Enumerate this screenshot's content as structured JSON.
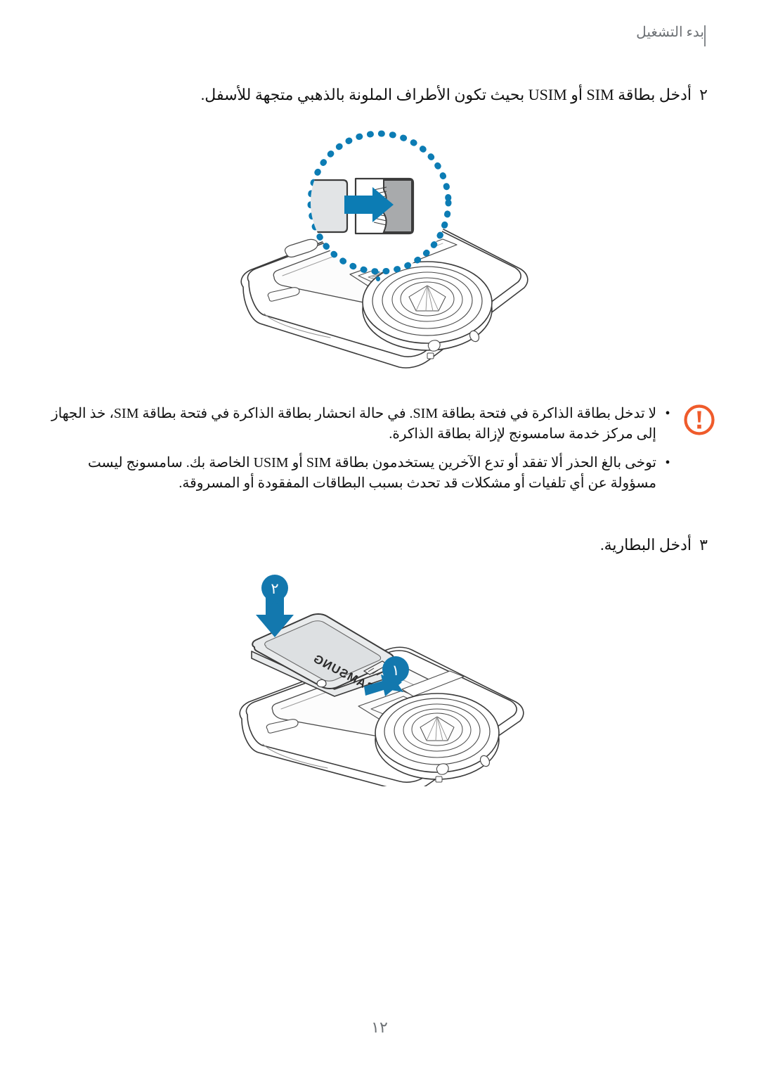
{
  "header": {
    "title": "بدء التشغيل"
  },
  "steps": [
    {
      "number": "٢",
      "text": "أدخل بطاقة SIM أو USIM بحيث تكون الأطراف الملونة بالذهبي متجهة للأسفل."
    },
    {
      "number": "٣",
      "text": "أدخل البطارية."
    }
  ],
  "note": {
    "icon": "warning-exclamation-icon",
    "icon_color": "#ef5b2b",
    "bullet": "•",
    "items": [
      "لا تدخل بطاقة الذاكرة في فتحة بطاقة SIM. في حالة انحشار بطاقة الذاكرة في فتحة بطاقة SIM، خذ الجهاز إلى مركز خدمة سامسونج لإزالة بطاقة الذاكرة.",
      "توخى بالغ الحذر ألا تفقد أو تدع الآخرين يستخدمون بطاقة SIM أو USIM الخاصة بك. سامسونج ليست مسؤولة عن أي تلفيات أو مشكلات قد تحدث بسبب البطاقات المفقودة أو المسروقة."
    ]
  },
  "figures": {
    "sim_insertion": {
      "name": "sim-card-insertion-illustration",
      "accent_color": "#0c7cb4",
      "callout": "dotted-circle-magnifier",
      "parts": {
        "sim_card": "sim-card",
        "slot": "sim-card-slot",
        "arrow": "insertion-arrow",
        "device": "phone-back-open"
      }
    },
    "battery_insertion": {
      "name": "battery-insertion-illustration",
      "accent_color": "#1378ae",
      "battery_label": "SAMSUNG",
      "badges": [
        {
          "label": "١",
          "name": "step-badge-1"
        },
        {
          "label": "٢",
          "name": "step-badge-2"
        }
      ],
      "parts": {
        "battery": "battery-pack",
        "device": "phone-back-open",
        "arrow_down": "battery-press-arrow",
        "arrow_side": "battery-contacts-arrow"
      }
    }
  },
  "footer": {
    "page_number": "١٢"
  }
}
